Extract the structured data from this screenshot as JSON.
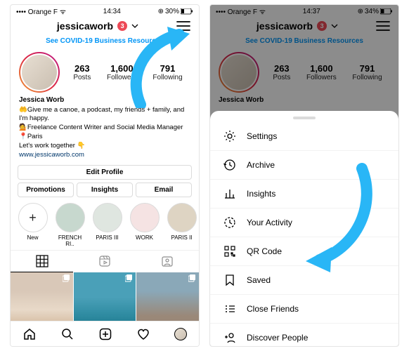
{
  "statusbar": {
    "carrier": "Orange F",
    "time_left": "14:34",
    "time_right": "14:37",
    "battery_left": "30%",
    "battery_right": "34%",
    "charging": true
  },
  "profile": {
    "username": "jessicaworb",
    "badge_count": "3",
    "covid_link": "See COVID-19 Business Resources",
    "name": "Jessica Worb",
    "bio_line1": "🤲Give me a canoe, a podcast, my friends + family, and I'm happy.",
    "bio_line2": "💁Freelance Content Writer and Social Media Manager",
    "bio_line3": "📍Paris",
    "bio_line4": "Let's work together 👇",
    "website": "www.jessicaworb.com"
  },
  "stats": {
    "posts_num": "263",
    "posts_lbl": "Posts",
    "followers_num": "1,600",
    "followers_lbl": "Followers",
    "following_num": "791",
    "following_lbl": "Following"
  },
  "buttons": {
    "edit": "Edit Profile",
    "promotions": "Promotions",
    "insights": "Insights",
    "email": "Email"
  },
  "highlights": [
    {
      "label": "New",
      "plus": true,
      "color": ""
    },
    {
      "label": "FRENCH RI..",
      "color": "#c7d8ce"
    },
    {
      "label": "PARIS III",
      "color": "#dfe6e0"
    },
    {
      "label": "WORK",
      "color": "#f5e3e3"
    },
    {
      "label": "PARIS II",
      "color": "#ded4c3"
    }
  ],
  "menu": [
    {
      "label": "Settings",
      "icon": "settings-icon"
    },
    {
      "label": "Archive",
      "icon": "archive-icon"
    },
    {
      "label": "Insights",
      "icon": "insights-icon"
    },
    {
      "label": "Your Activity",
      "icon": "activity-icon"
    },
    {
      "label": "QR Code",
      "icon": "qr-icon"
    },
    {
      "label": "Saved",
      "icon": "saved-icon"
    },
    {
      "label": "Close Friends",
      "icon": "closefriends-icon"
    },
    {
      "label": "Discover People",
      "icon": "discover-icon"
    }
  ],
  "colors": {
    "accent": "#29b6f6"
  }
}
